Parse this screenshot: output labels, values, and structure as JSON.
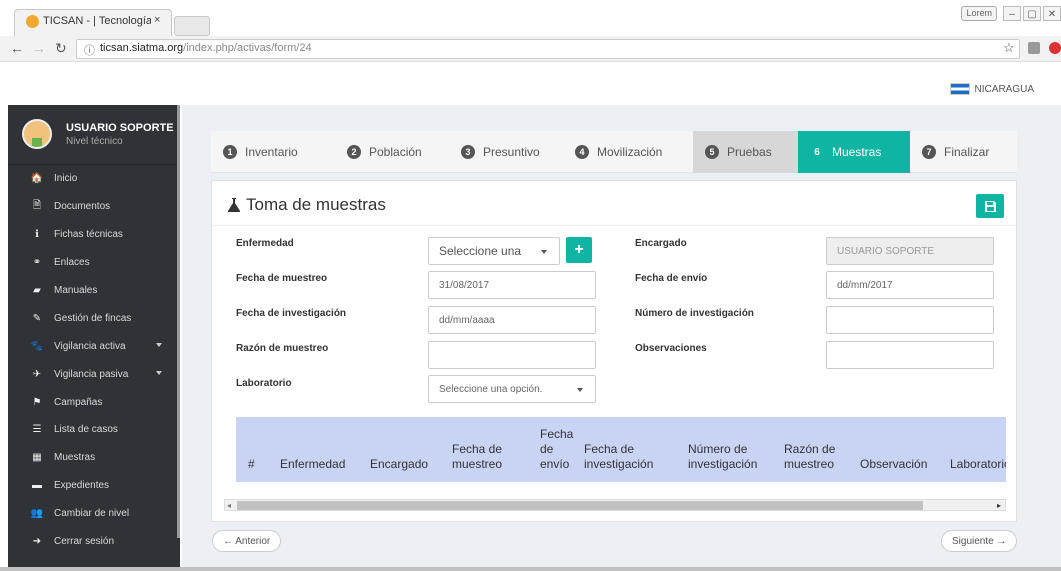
{
  "browser": {
    "tab_title": "TICSAN - | Tecnología de",
    "tab_close": "×",
    "badge": "Lorem",
    "url_host": "ticsan.siatma.org",
    "url_path": "/index.php/activas/form/24",
    "icons": [
      "back-arrow-icon",
      "forward-arrow-icon",
      "reload-icon",
      "info-icon",
      "star-icon"
    ]
  },
  "header": {
    "country": "NICARAGUA"
  },
  "sidebar": {
    "user_name": "USUARIO SOPORTE",
    "user_level": "Nivel técnico",
    "items": [
      {
        "label": "Inicio",
        "icon": "🏠",
        "caret": false
      },
      {
        "label": "Documentos",
        "icon": "🗎",
        "caret": false
      },
      {
        "label": "Fichas técnicas",
        "icon": "ℹ",
        "caret": false
      },
      {
        "label": "Enlaces",
        "icon": "⚭",
        "caret": false
      },
      {
        "label": "Manuales",
        "icon": "▰",
        "caret": false
      },
      {
        "label": "Gestión de fincas",
        "icon": "✎",
        "caret": false
      },
      {
        "label": "Vigilancia activa",
        "icon": "🐾",
        "caret": true
      },
      {
        "label": "Vigilancia pasiva",
        "icon": "✈",
        "caret": true
      },
      {
        "label": "Campañas",
        "icon": "⚑",
        "caret": false
      },
      {
        "label": "Lista de casos",
        "icon": "☰",
        "caret": false
      },
      {
        "label": "Muestras",
        "icon": "▦",
        "caret": false
      },
      {
        "label": "Expedientes",
        "icon": "▬",
        "caret": false
      },
      {
        "label": "Cambiar de nivel",
        "icon": "👥",
        "caret": false
      },
      {
        "label": "Cerrar sesión",
        "icon": "➜",
        "caret": false
      }
    ]
  },
  "wizard": {
    "steps": [
      {
        "num": "1",
        "label": "Inventario",
        "state": "normal"
      },
      {
        "num": "2",
        "label": "Población",
        "state": "normal"
      },
      {
        "num": "3",
        "label": "Presuntivo",
        "state": "normal"
      },
      {
        "num": "4",
        "label": "Movilización",
        "state": "normal"
      },
      {
        "num": "5",
        "label": "Pruebas",
        "state": "done"
      },
      {
        "num": "6",
        "label": "Muestras",
        "state": "active"
      },
      {
        "num": "7",
        "label": "Finalizar",
        "state": "normal"
      }
    ]
  },
  "panel": {
    "title": "Toma de muestras",
    "save_icon": "💾"
  },
  "form": {
    "enfermedad_label": "Enfermedad",
    "enfermedad_value": "Seleccione una",
    "add_label": "+",
    "encargado_label": "Encargado",
    "encargado_value": "USUARIO SOPORTE",
    "fecha_muestreo_label": "Fecha de muestreo",
    "fecha_muestreo_value": "31/08/2017",
    "fecha_envio_label": "Fecha de envío",
    "fecha_envio_value": "dd/mm/2017",
    "fecha_investigacion_label": "Fecha de investigación",
    "fecha_investigacion_value": "dd/mm/aaaa",
    "numero_investigacion_label": "Número de investigación",
    "numero_investigacion_value": "",
    "razon_muestreo_label": "Razón de muestreo",
    "razon_muestreo_value": "",
    "observaciones_label": "Observaciones",
    "observaciones_value": "",
    "laboratorio_label": "Laboratorio",
    "laboratorio_value": "Seleccione una opción."
  },
  "table": {
    "headers": [
      "#",
      "Enfermedad",
      "Encargado",
      "Fecha de muestreo",
      "Fecha de envío",
      "Fecha de investigación",
      "Número de investigación",
      "Razón de muestreo",
      "Observación",
      "Laboratorio"
    ]
  },
  "pager": {
    "prev": "← Anterior",
    "next": "Siguiente →"
  },
  "colors": {
    "accent": "#0fb4a3",
    "sidebar": "#2f3337",
    "table_header": "#c9d4f5"
  }
}
